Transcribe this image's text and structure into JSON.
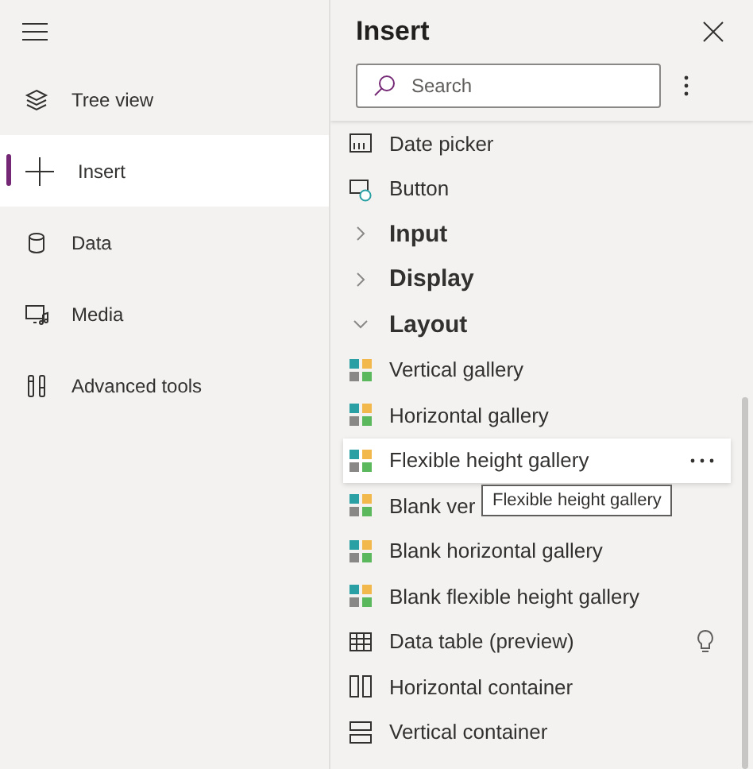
{
  "nav": {
    "items": [
      {
        "label": "Tree view",
        "selected": false
      },
      {
        "label": "Insert",
        "selected": true
      },
      {
        "label": "Data",
        "selected": false
      },
      {
        "label": "Media",
        "selected": false
      },
      {
        "label": "Advanced tools",
        "selected": false
      }
    ]
  },
  "panel": {
    "title": "Insert",
    "search": {
      "placeholder": "Search"
    },
    "items": [
      {
        "kind": "item",
        "label": "Date picker",
        "hovered": false
      },
      {
        "kind": "item",
        "label": "Button",
        "hovered": false
      },
      {
        "kind": "group",
        "label": "Input",
        "expanded": false
      },
      {
        "kind": "group",
        "label": "Display",
        "expanded": false
      },
      {
        "kind": "group",
        "label": "Layout",
        "expanded": true
      },
      {
        "kind": "item",
        "label": "Vertical gallery",
        "hovered": false
      },
      {
        "kind": "item",
        "label": "Horizontal gallery",
        "hovered": false
      },
      {
        "kind": "item",
        "label": "Flexible height gallery",
        "hovered": true
      },
      {
        "kind": "item",
        "label": "Blank ver",
        "hovered": false
      },
      {
        "kind": "item",
        "label": "Blank horizontal gallery",
        "hovered": false
      },
      {
        "kind": "item",
        "label": "Blank flexible height gallery",
        "hovered": false
      },
      {
        "kind": "item",
        "label": "Data table (preview)",
        "hovered": false,
        "preview_tip": true
      },
      {
        "kind": "item",
        "label": "Horizontal container",
        "hovered": false
      },
      {
        "kind": "item",
        "label": "Vertical container",
        "hovered": false
      }
    ],
    "tooltip": "Flexible height gallery"
  }
}
